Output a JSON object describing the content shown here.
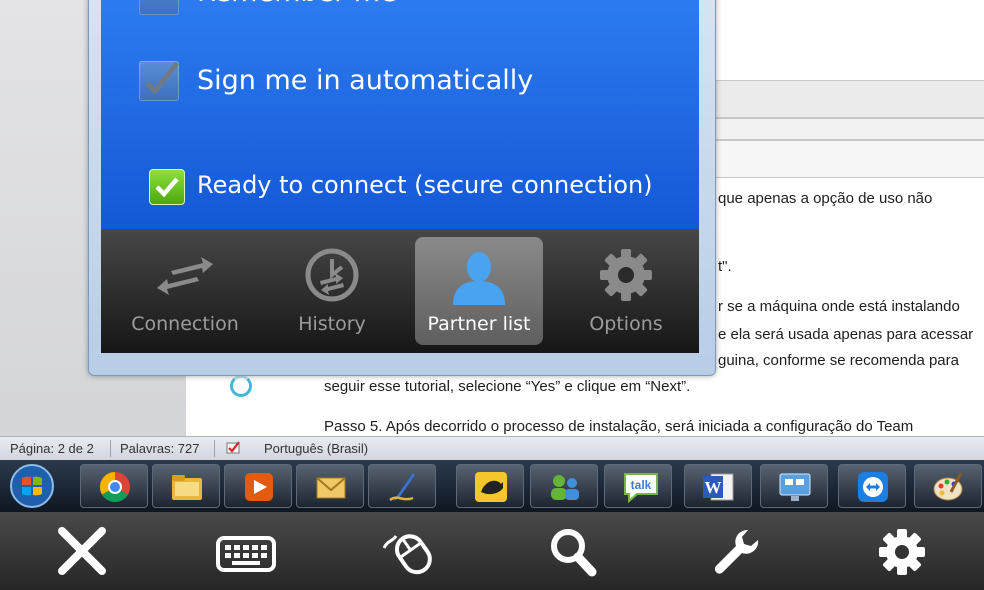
{
  "tv_app": {
    "remember_me_label": "Remember me",
    "auto_signin_label": "Sign me in automatically",
    "ready_status": "Ready to connect (secure connection)",
    "tabs": [
      {
        "label": "Connection",
        "icon": "connection-arrows-icon",
        "active": false
      },
      {
        "label": "History",
        "icon": "history-clock-icon",
        "active": false
      },
      {
        "label": "Partner list",
        "icon": "partner-person-icon",
        "active": true
      },
      {
        "label": "Options",
        "icon": "options-gear-icon",
        "active": false
      }
    ]
  },
  "document": {
    "lines": [
      "que apenas a opção de uso não",
      "t\".",
      "r se a máquina onde está instalando",
      "e ela será usada apenas para acessar",
      "guina, conforme se recomenda para",
      "seguir esse tutorial, selecione “Yes” e clique em “Next”.",
      "Passo 5. Após decorrido o processo de instalação, será iniciada a configuração do Team"
    ]
  },
  "statusbar": {
    "page": "Página: 2 de 2",
    "words": "Palavras: 727",
    "language": "Português (Brasil)"
  },
  "taskbar": {
    "items": [
      "start-orb",
      "chrome-icon",
      "file-explorer-icon",
      "media-player-icon",
      "mail-icon",
      "pen-app-icon",
      "bird-app-icon",
      "contacts-app-icon",
      "gtalk-icon",
      "word-icon",
      "remote-desktop-icon",
      "teamviewer-icon",
      "paint-icon"
    ],
    "talk_text": "talk",
    "word_text": "W"
  },
  "remote_toolbar": {
    "buttons": [
      "close-icon",
      "keyboard-icon",
      "mouse-icon",
      "search-icon",
      "wrench-icon",
      "settings-gear-icon"
    ]
  },
  "colors": {
    "panel_blue": "#1f6ae3",
    "ready_green": "#6cc523",
    "tab_inactive_text": "#9c9c9c"
  }
}
